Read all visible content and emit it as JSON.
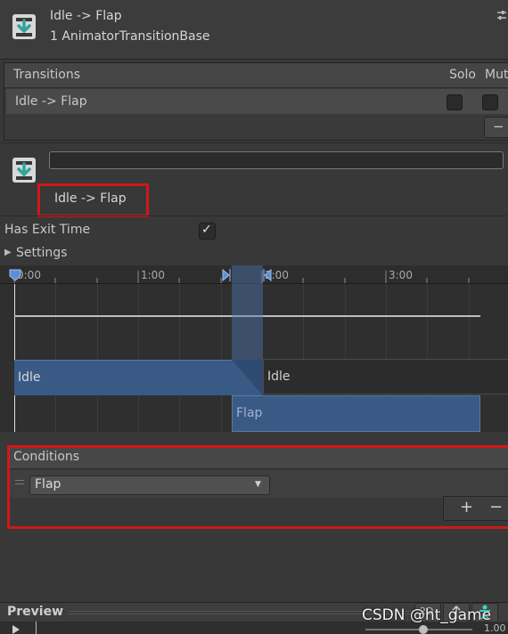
{
  "header": {
    "title": "Idle -> Flap",
    "subtitle": "1 AnimatorTransitionBase",
    "transition_icon": "transition-arrow-icon",
    "settings_icon": "sliders-icon"
  },
  "transitions": {
    "header_label": "Transitions",
    "solo_label": "Solo",
    "mute_label": "Mut",
    "rows": [
      {
        "label": "Idle -> Flap",
        "solo": false,
        "mute": false
      }
    ],
    "remove_label": "−"
  },
  "selected": {
    "name_field_value": "",
    "label": "Idle -> Flap"
  },
  "has_exit_time": {
    "label": "Has Exit Time",
    "checked": true,
    "check_glyph": "✓"
  },
  "settings": {
    "label": "Settings",
    "expanded": false,
    "arrow_glyph": "▶"
  },
  "timeline": {
    "ticks": [
      "0:00",
      "1:00",
      "2:00",
      "3:00"
    ],
    "source_state": "Idle",
    "target_state_top": "Idle",
    "target_state": "Flap"
  },
  "conditions": {
    "header_label": "Conditions",
    "rows": [
      {
        "parameter": "Flap"
      }
    ],
    "dropdown_arrow": "▼",
    "add_label": "+",
    "remove_label": "−"
  },
  "preview": {
    "label": "Preview",
    "mode_2d": "2D",
    "speed": "1.00"
  },
  "watermark": "CSDN @ht_game",
  "colors": {
    "highlight_red": "#d01818",
    "transition_blue": "#3a5a86",
    "panel_bg": "#383838"
  }
}
